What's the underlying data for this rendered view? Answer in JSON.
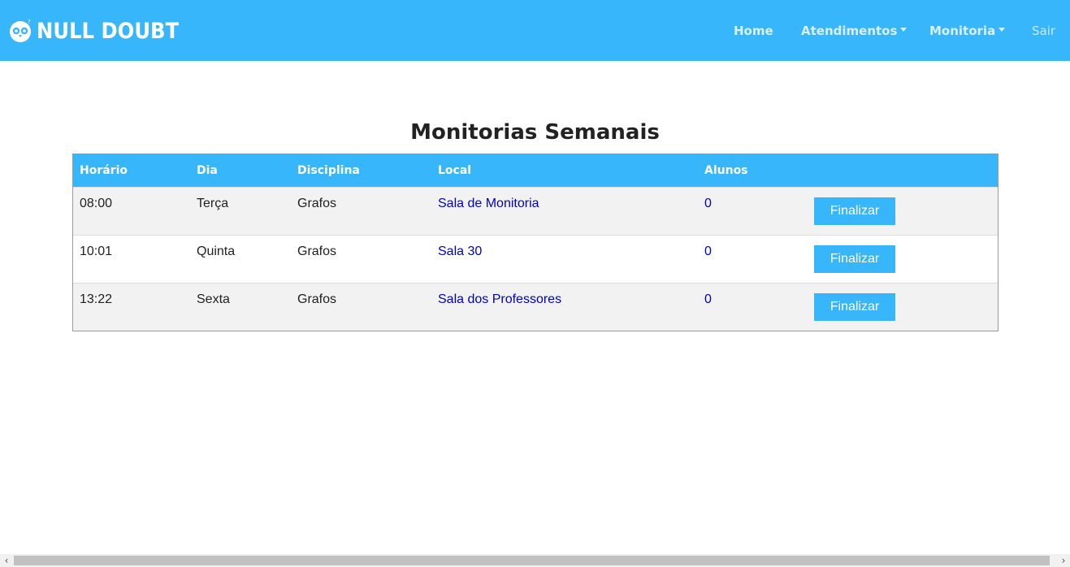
{
  "brand": {
    "name": "NULL DOUBT",
    "logo": "owl-icon"
  },
  "nav": {
    "home": "Home",
    "atendimentos": "Atendimentos",
    "monitoria": "Monitoria",
    "sair": "Sair"
  },
  "page": {
    "title": "Monitorias Semanais"
  },
  "table": {
    "headers": [
      "Horário",
      "Dia",
      "Disciplina",
      "Local",
      "Alunos",
      ""
    ],
    "rows": [
      {
        "horario": "08:00",
        "dia": "Terça",
        "disciplina": "Grafos",
        "local": "Sala de Monitoria",
        "alunos": "0",
        "action": "Finalizar"
      },
      {
        "horario": "10:01",
        "dia": "Quinta",
        "disciplina": "Grafos",
        "local": "Sala 30",
        "alunos": "0",
        "action": "Finalizar"
      },
      {
        "horario": "13:22",
        "dia": "Sexta",
        "disciplina": "Grafos",
        "local": "Sala dos Professores",
        "alunos": "0",
        "action": "Finalizar"
      }
    ]
  },
  "scrollbar": {
    "left_arrow": "‹",
    "right_arrow": "›"
  },
  "colors": {
    "primary": "#38b6fc",
    "link": "#0000cd",
    "row_alt": "#f2f2f2"
  }
}
